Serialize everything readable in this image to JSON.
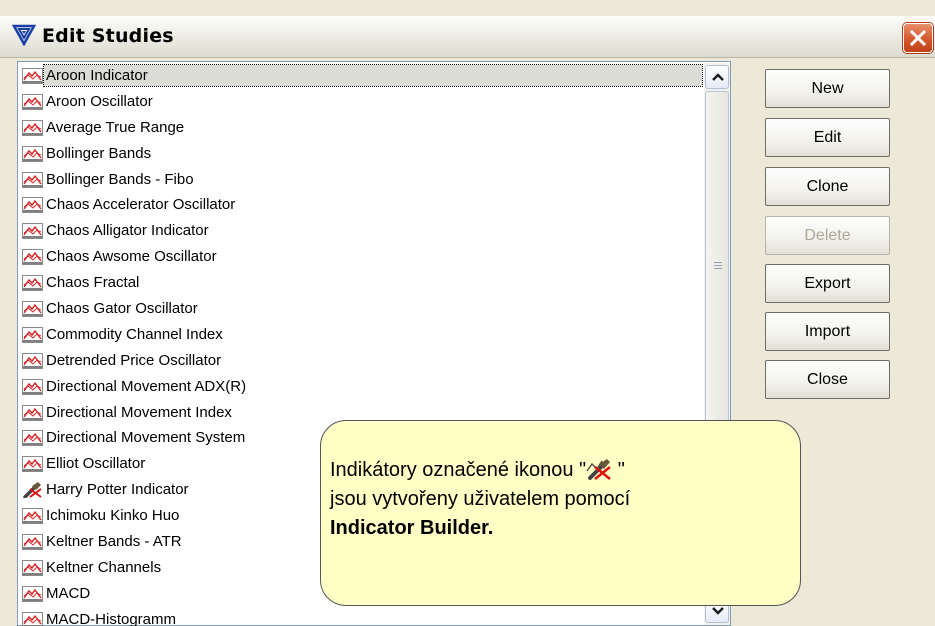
{
  "window": {
    "title": "Edit Studies",
    "app_icon": "study-logo-icon",
    "close_icon": "close-icon",
    "colors": {
      "close": "#d4572f",
      "callout": "#ffffc6"
    }
  },
  "studies": [
    {
      "label": "Aroon Indicator",
      "icon": "study-chart-icon"
    },
    {
      "label": "Aroon Oscillator",
      "icon": "study-chart-icon"
    },
    {
      "label": "Average True Range",
      "icon": "study-chart-icon"
    },
    {
      "label": "Bollinger Bands",
      "icon": "study-chart-icon"
    },
    {
      "label": "Bollinger Bands - Fibo",
      "icon": "study-chart-icon"
    },
    {
      "label": "Chaos Accelerator Oscillator",
      "icon": "study-chart-icon"
    },
    {
      "label": "Chaos Alligator Indicator",
      "icon": "study-chart-icon"
    },
    {
      "label": "Chaos Awsome Oscillator",
      "icon": "study-chart-icon"
    },
    {
      "label": "Chaos Fractal",
      "icon": "study-chart-icon"
    },
    {
      "label": "Chaos Gator Oscillator",
      "icon": "study-chart-icon"
    },
    {
      "label": "Commodity Channel Index",
      "icon": "study-chart-icon"
    },
    {
      "label": "Detrended Price Oscillator",
      "icon": "study-chart-icon"
    },
    {
      "label": "Directional Movement ADX(R)",
      "icon": "study-chart-icon"
    },
    {
      "label": "Directional Movement Index",
      "icon": "study-chart-icon"
    },
    {
      "label": "Directional Movement System",
      "icon": "study-chart-icon"
    },
    {
      "label": "Elliot Oscillator",
      "icon": "study-chart-icon"
    },
    {
      "label": "Harry Potter Indicator",
      "icon": "user-built-indicator-icon"
    },
    {
      "label": "Ichimoku Kinko Huo",
      "icon": "study-chart-icon"
    },
    {
      "label": "Keltner Bands - ATR",
      "icon": "study-chart-icon"
    },
    {
      "label": "Keltner Channels",
      "icon": "study-chart-icon"
    },
    {
      "label": "MACD",
      "icon": "study-chart-icon"
    },
    {
      "label": "MACD-Histogramm",
      "icon": "study-chart-icon"
    }
  ],
  "selected_index": 0,
  "buttons": {
    "new": "New",
    "edit": "Edit",
    "clone": "Clone",
    "delete": "Delete",
    "export": "Export",
    "import": "Import",
    "close": "Close"
  },
  "buttons_disabled": [
    "delete"
  ],
  "callout": {
    "line1_before": "Indikátory označené ikonou \"",
    "line1_after": " \"",
    "line2": "jsou vytvořeny uživatelem pomocí",
    "line3": "Indicator Builder."
  }
}
